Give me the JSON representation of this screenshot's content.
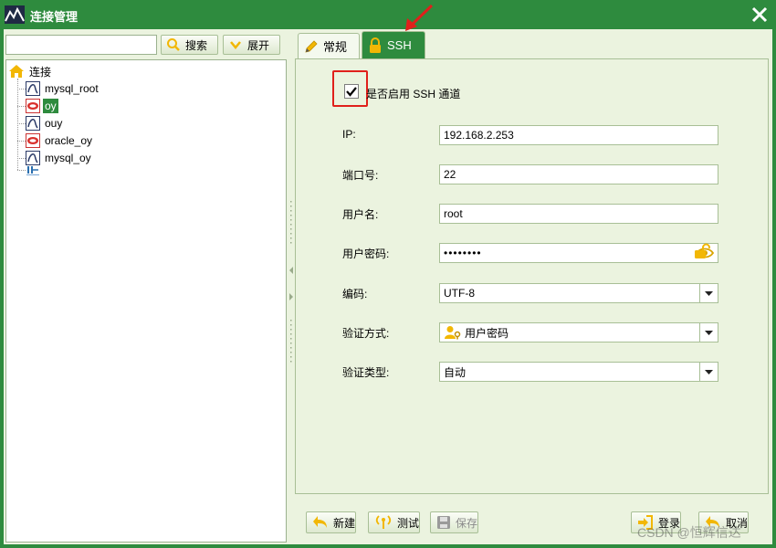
{
  "window": {
    "title": "连接管理"
  },
  "left_pane": {
    "search_placeholder": "",
    "search_button": "搜索",
    "expand_button": "展开",
    "tree": {
      "root_label": "连接",
      "items": [
        {
          "label": "mysql_root",
          "icon": "mysql-icon",
          "selected": false
        },
        {
          "label": "oy",
          "icon": "oracle-icon",
          "selected": true
        },
        {
          "label": "ouy",
          "icon": "mysql-icon",
          "selected": false
        },
        {
          "label": "oracle_oy",
          "icon": "oracle-icon",
          "selected": false
        },
        {
          "label": "mysql_oy",
          "icon": "mysql-icon",
          "selected": false
        },
        {
          "label": "",
          "icon": "other-db-icon",
          "selected": false
        }
      ]
    }
  },
  "tabs": [
    {
      "label": "常规",
      "icon": "pencil-icon",
      "active": false
    },
    {
      "label": "SSH",
      "icon": "lock-icon",
      "active": true
    }
  ],
  "ssh": {
    "enable_label": "是否启用 SSH 通道",
    "enabled": true,
    "fields": {
      "ip_label": "IP:",
      "ip_value": "192.168.2.253",
      "port_label": "端口号:",
      "port_value": "22",
      "username_label": "用户名:",
      "username_value": "root",
      "password_label": "用户密码:",
      "password_value": "••••••••",
      "encoding_label": "编码:",
      "encoding_value": "UTF-8",
      "auth_label": "验证方式:",
      "auth_value": "用户密码",
      "auth_type_label": "验证类型:",
      "auth_type_value": "自动"
    }
  },
  "buttons": {
    "new": "新建",
    "test": "测试",
    "save": "保存",
    "login": "登录",
    "cancel": "取消"
  },
  "watermark": "CSDN @恒辉信达",
  "colors": {
    "brand_green": "#2e8b3e",
    "panel_bg": "#ebf3df",
    "highlight_red": "#e0201b",
    "icon_yellow": "#f2b705"
  }
}
